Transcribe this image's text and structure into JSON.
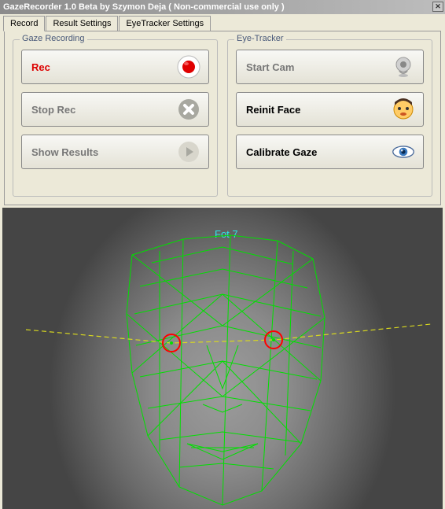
{
  "window": {
    "title": "GazeRecorder 1.0 Beta  by Szymon Deja  ( Non-commercial use only )"
  },
  "tabs": [
    {
      "label": "Record",
      "active": true
    },
    {
      "label": "Result Settings",
      "active": false
    },
    {
      "label": "EyeTracker Settings",
      "active": false
    }
  ],
  "groups": {
    "gaze": {
      "title": "Gaze Recording",
      "rec": "Rec",
      "stop": "Stop Rec",
      "show": "Show Results"
    },
    "eye": {
      "title": "Eye-Tracker",
      "startcam": "Start Cam",
      "reinit": "Reinit Face",
      "calib": "Calibrate Gaze"
    }
  },
  "preview": {
    "overlay_label": "Fot 7"
  }
}
